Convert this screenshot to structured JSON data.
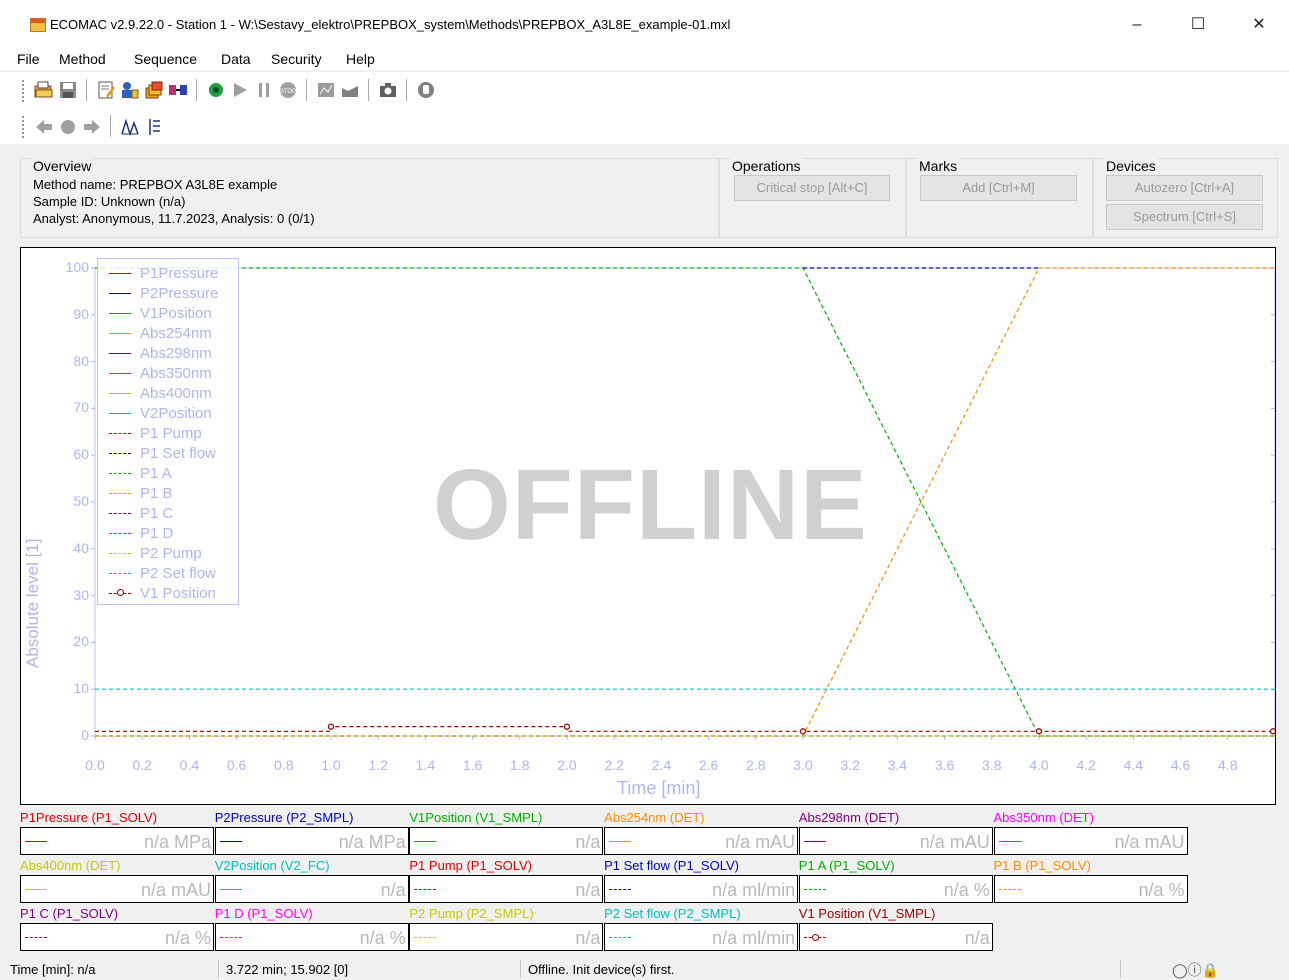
{
  "window": {
    "title": "ECOMAC v2.9.22.0 - Station 1 - W:\\Sestavy_elektro\\PREPBOX_system\\Methods\\PREPBOX_A3L8E_example-01.mxl",
    "minimize": "–",
    "maximize": "☐",
    "close": "✕"
  },
  "menu": [
    "File",
    "Method",
    "Sequence",
    "Data",
    "Security",
    "Help"
  ],
  "overview": {
    "title": "Overview",
    "method_name": "Method name: PREPBOX A3L8E example",
    "sample_id": "Sample ID: Unknown (n/a)",
    "analyst": "Analyst: Anonymous, 11.7.2023, Analysis: 0 (0/1)"
  },
  "operations": {
    "title": "Operations",
    "critical_stop": "Critical stop [Alt+C]"
  },
  "marks": {
    "title": "Marks",
    "add": "Add [Ctrl+M]"
  },
  "devices": {
    "title": "Devices",
    "autozero": "Autozero [Ctrl+A]",
    "spectrum": "Spectrum [Ctrl+S]"
  },
  "chart_data": {
    "type": "line",
    "watermark": "OFFLINE",
    "xlabel": "Time [min]",
    "ylabel": "Absolute level [1]",
    "xlim": [
      0,
      4.8
    ],
    "ylim": [
      0,
      100
    ],
    "xticks": [
      "0.0",
      "0.2",
      "0.4",
      "0.6",
      "0.8",
      "1.0",
      "1.2",
      "1.4",
      "1.6",
      "1.8",
      "2.0",
      "2.2",
      "2.4",
      "2.6",
      "2.8",
      "3.0",
      "3.2",
      "3.4",
      "3.6",
      "3.8",
      "4.0",
      "4.2",
      "4.4",
      "4.6",
      "4.8"
    ],
    "yticks": [
      "0",
      "10",
      "20",
      "30",
      "40",
      "50",
      "60",
      "70",
      "80",
      "90",
      "100"
    ],
    "legend_position": "top-left",
    "legend": [
      {
        "name": "P1Pressure",
        "color": "#e00000",
        "style": "solid"
      },
      {
        "name": "P2Pressure",
        "color": "#0000c8",
        "style": "solid"
      },
      {
        "name": "V1Position",
        "color": "#00b000",
        "style": "solid"
      },
      {
        "name": "Abs254nm",
        "color": "#ff8c00",
        "style": "solid"
      },
      {
        "name": "Abs298nm",
        "color": "#800080",
        "style": "solid"
      },
      {
        "name": "Abs350nm",
        "color": "#ff00ff",
        "style": "solid"
      },
      {
        "name": "Abs400nm",
        "color": "#c8c800",
        "style": "solid"
      },
      {
        "name": "V2Position",
        "color": "#00c0c0",
        "style": "solid"
      },
      {
        "name": "P1 Pump",
        "color": "#e00000",
        "style": "dashed"
      },
      {
        "name": "P1 Set flow",
        "color": "#0000c8",
        "style": "dashed"
      },
      {
        "name": "P1 A",
        "color": "#00b000",
        "style": "dashed"
      },
      {
        "name": "P1 B",
        "color": "#ff8c00",
        "style": "dashed"
      },
      {
        "name": "P1 C",
        "color": "#800080",
        "style": "dashed"
      },
      {
        "name": "P1 D",
        "color": "#ff00ff",
        "style": "dashed"
      },
      {
        "name": "P2 Pump",
        "color": "#c8c800",
        "style": "dashed"
      },
      {
        "name": "P2 Set flow",
        "color": "#00c0c0",
        "style": "dashed"
      },
      {
        "name": "V1 Position",
        "color": "#a00000",
        "style": "dashed-marker"
      }
    ],
    "series": [
      {
        "name": "P1 A",
        "color": "#00b000",
        "x": [
          0,
          3.0,
          4.0,
          5.0
        ],
        "y": [
          100,
          100,
          0,
          0
        ]
      },
      {
        "name": "P1 B",
        "color": "#ff8c00",
        "x": [
          0,
          3.0,
          4.0,
          5.0
        ],
        "y": [
          0,
          0,
          100,
          100
        ]
      },
      {
        "name": "P1 Set flow",
        "color": "#0000c8",
        "x": [
          3.0,
          4.0
        ],
        "y": [
          100,
          100
        ]
      },
      {
        "name": "P2 Set flow",
        "color": "#00c0c0",
        "x": [
          0,
          5.0
        ],
        "y": [
          10,
          10
        ]
      },
      {
        "name": "P1 C",
        "color": "#800080",
        "x": [
          0,
          5.0
        ],
        "y": [
          0,
          0
        ]
      },
      {
        "name": "P2 Pump",
        "color": "#c8c800",
        "x": [
          0,
          5.0
        ],
        "y": [
          0,
          0
        ]
      },
      {
        "name": "V1 Position",
        "color": "#a00000",
        "x": [
          0,
          1.0,
          1.0,
          2.0,
          2.0,
          3.0,
          4.0,
          5.0
        ],
        "y": [
          1,
          1,
          2,
          2,
          1,
          1,
          1,
          1
        ],
        "markers": [
          [
            1.0,
            2
          ],
          [
            2.0,
            2
          ],
          [
            3.0,
            1
          ],
          [
            4.0,
            1
          ],
          [
            5.0,
            1
          ]
        ]
      }
    ]
  },
  "readouts": [
    {
      "title": "P1Pressure (P1_SOLV)",
      "color": "#e00000",
      "style": "solid",
      "value": "n/a MPa"
    },
    {
      "title": "P2Pressure (P2_SMPL)",
      "color": "#0000c8",
      "style": "solid",
      "value": "n/a MPa"
    },
    {
      "title": "V1Position (V1_SMPL)",
      "color": "#00b000",
      "style": "solid",
      "value": "n/a"
    },
    {
      "title": "Abs254nm (DET)",
      "color": "#ff8c00",
      "style": "solid",
      "value": "n/a mAU"
    },
    {
      "title": "Abs298nm (DET)",
      "color": "#800080",
      "style": "solid",
      "value": "n/a mAU"
    },
    {
      "title": "Abs350nm (DET)",
      "color": "#ff00ff",
      "style": "solid",
      "value": "n/a mAU"
    },
    {
      "title": "Abs400nm (DET)",
      "color": "#c8c800",
      "style": "solid",
      "value": "n/a mAU"
    },
    {
      "title": "V2Position (V2_FC)",
      "color": "#00c0c0",
      "style": "solid",
      "value": "n/a"
    },
    {
      "title": "P1 Pump (P1_SOLV)",
      "color": "#e00000",
      "style": "dashed",
      "value": "n/a"
    },
    {
      "title": "P1 Set flow (P1_SOLV)",
      "color": "#0000c8",
      "style": "dashed",
      "value": "n/a ml/min"
    },
    {
      "title": "P1 A (P1_SOLV)",
      "color": "#00b000",
      "style": "dashed",
      "value": "n/a %"
    },
    {
      "title": "P1 B (P1_SOLV)",
      "color": "#ff8c00",
      "style": "dashed",
      "value": "n/a %"
    },
    {
      "title": "P1 C (P1_SOLV)",
      "color": "#800080",
      "style": "dashed",
      "value": "n/a %"
    },
    {
      "title": "P1 D (P1_SOLV)",
      "color": "#ff00ff",
      "style": "dashed",
      "value": "n/a %"
    },
    {
      "title": "P2 Pump (P2_SMPL)",
      "color": "#c8c800",
      "style": "dashed",
      "value": "n/a"
    },
    {
      "title": "P2 Set flow (P2_SMPL)",
      "color": "#00c0c0",
      "style": "dashed",
      "value": "n/a ml/min"
    },
    {
      "title": "V1 Position (V1_SMPL)",
      "color": "#a00000",
      "style": "dashed-marker",
      "value": "n/a"
    }
  ],
  "status": {
    "time": "Time [min]: n/a",
    "cursor": "3.722 min; 15.902   [0]",
    "message": "Offline. Init device(s) first.",
    "icons": "◯ⓘ🔒"
  }
}
